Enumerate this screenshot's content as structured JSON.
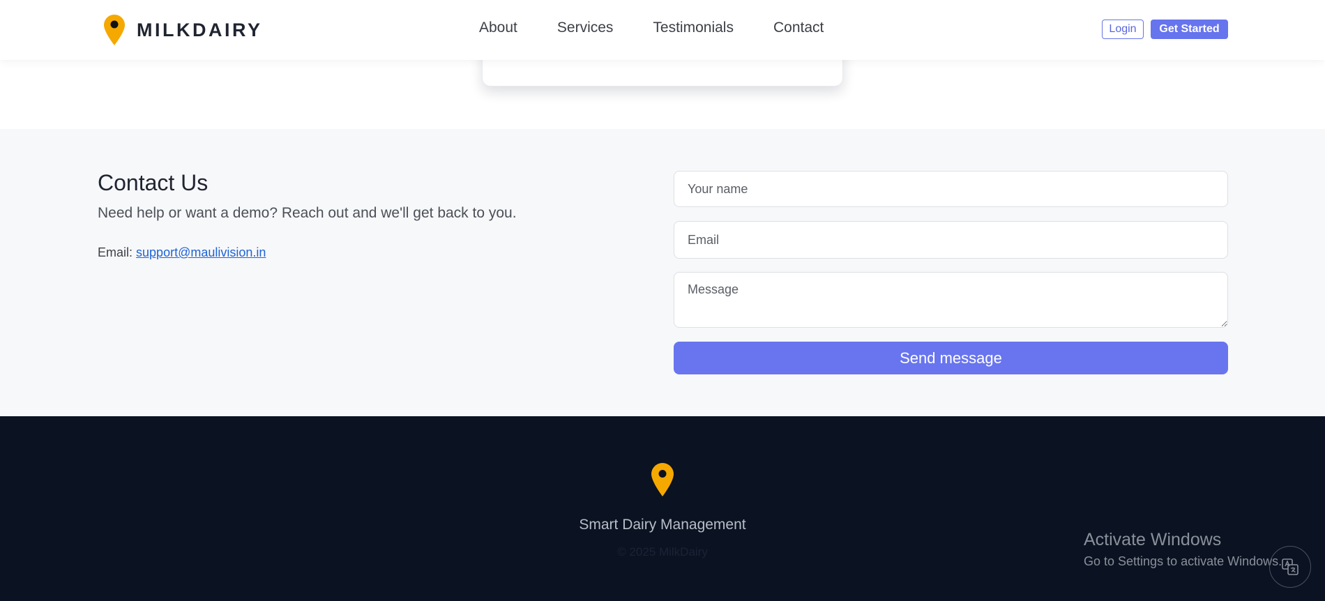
{
  "header": {
    "brand_name": "MILKDAIRY",
    "nav": [
      "About",
      "Services",
      "Testimonials",
      "Contact"
    ],
    "login_label": "Login",
    "get_started_label": "Get Started"
  },
  "contact": {
    "title": "Contact Us",
    "subtitle": "Need help or want a demo? Reach out and we'll get back to you.",
    "email_label": "Email:",
    "email_address": "support@maulivision.in",
    "form": {
      "name_placeholder": "Your name",
      "email_placeholder": "Email",
      "message_placeholder": "Message",
      "send_label": "Send message"
    }
  },
  "footer": {
    "tagline": "Smart Dairy Management",
    "copyright": "© 2025 MilkDairy"
  },
  "system": {
    "activate_title": "Activate Windows",
    "activate_sub": "Go to Settings to activate Windows."
  },
  "icons": {
    "brand": "map-pin-icon",
    "footer": "map-pin-icon",
    "translate": "translate-icon"
  },
  "colors": {
    "accent": "#6674ee",
    "pin": "#f5a800",
    "link": "#1e63d6",
    "footer_bg": "#0b1221",
    "contact_bg": "#f7f8fa"
  }
}
